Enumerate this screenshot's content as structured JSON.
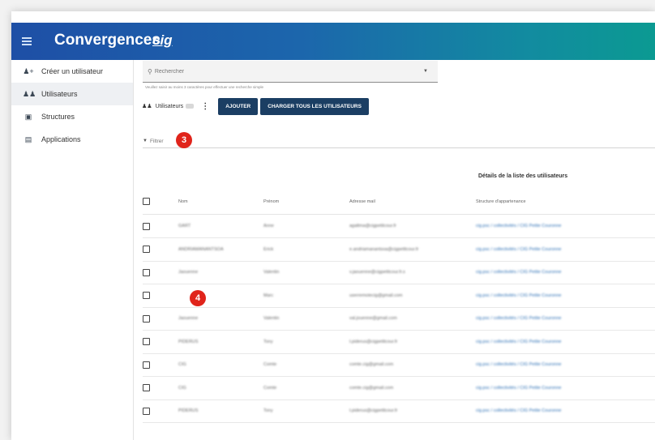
{
  "app": {
    "title": "Convergences",
    "logo_text": "cig",
    "logo_sub": ""
  },
  "sidebar": {
    "items": [
      {
        "label": "Créer un utilisateur",
        "icon": "add-user-icon"
      },
      {
        "label": "Utilisateurs",
        "icon": "users-icon"
      },
      {
        "label": "Structures",
        "icon": "building-icon"
      },
      {
        "label": "Applications",
        "icon": "window-icon"
      }
    ]
  },
  "search": {
    "placeholder": "Rechercher",
    "hint": "Veuillez saisir au moins 3 caractères pour effectuer une recherche simple"
  },
  "toolbar": {
    "users_label": "Utilisateurs",
    "add_label": "AJOUTER",
    "load_all_label": "CHARGER TOUS LES UTILISATEURS"
  },
  "filter": {
    "placeholder": "Filtrer"
  },
  "callouts": {
    "filter_number": "3",
    "list_number": "4"
  },
  "details_title": "Détails de la liste des utilisateurs",
  "table": {
    "columns": [
      "Nom",
      "Prénom",
      "Adresse mail",
      "Structure d'appartenance"
    ],
    "rows": [
      {
        "nom": "GART",
        "prenom": "Anne",
        "email": "agaltma@cigpetitcour.fr",
        "structure": "cig.psc / collectivités / CIG Petite Couronne"
      },
      {
        "nom": "ANDRIAMANANTSOA",
        "prenom": "Erick",
        "email": "e.andriamanantsoa@cigpetitcour.fr",
        "structure": "cig.psc / collectivités / CIG Petite Couronne"
      },
      {
        "nom": "Jaouenne",
        "prenom": "Valentin",
        "email": "v.jaouenne@cigpetitcour.fr.s",
        "structure": "cig.psc / collectivités / CIG Petite Couronne"
      },
      {
        "nom": "",
        "prenom": "Marc",
        "email": "userremotecig@gmail.com",
        "structure": "cig.psc / collectivités / CIG Petite Couronne"
      },
      {
        "nom": "Jaouenne",
        "prenom": "Valentin",
        "email": "val.jouenne@gmail.com",
        "structure": "cig.psc / collectivités / CIG Petite Couronne"
      },
      {
        "nom": "PIDERUS",
        "prenom": "Tony",
        "email": "t.piderus@cigpetitcour.fr",
        "structure": "cig.psc / collectivités / CIG Petite Couronne"
      },
      {
        "nom": "CIG",
        "prenom": "Comte",
        "email": "comte.cig@gmail.com",
        "structure": "cig.psc / collectivités / CIG Petite Couronne"
      },
      {
        "nom": "CIG",
        "prenom": "Comte",
        "email": "comte.cig@gmail.com",
        "structure": "cig.psc / collectivités / CIG Petite Couronne"
      },
      {
        "nom": "PIDERUS",
        "prenom": "Tony",
        "email": "t.piderus@cigpetitcour.fr",
        "structure": "cig.psc / collectivités / CIG Petite Couronne"
      }
    ]
  },
  "colors": {
    "topbar_start": "#1e4fa6",
    "topbar_end": "#0b9a92",
    "button": "#1b3e63",
    "callout": "#e0241b",
    "link": "#2c6fb4"
  }
}
